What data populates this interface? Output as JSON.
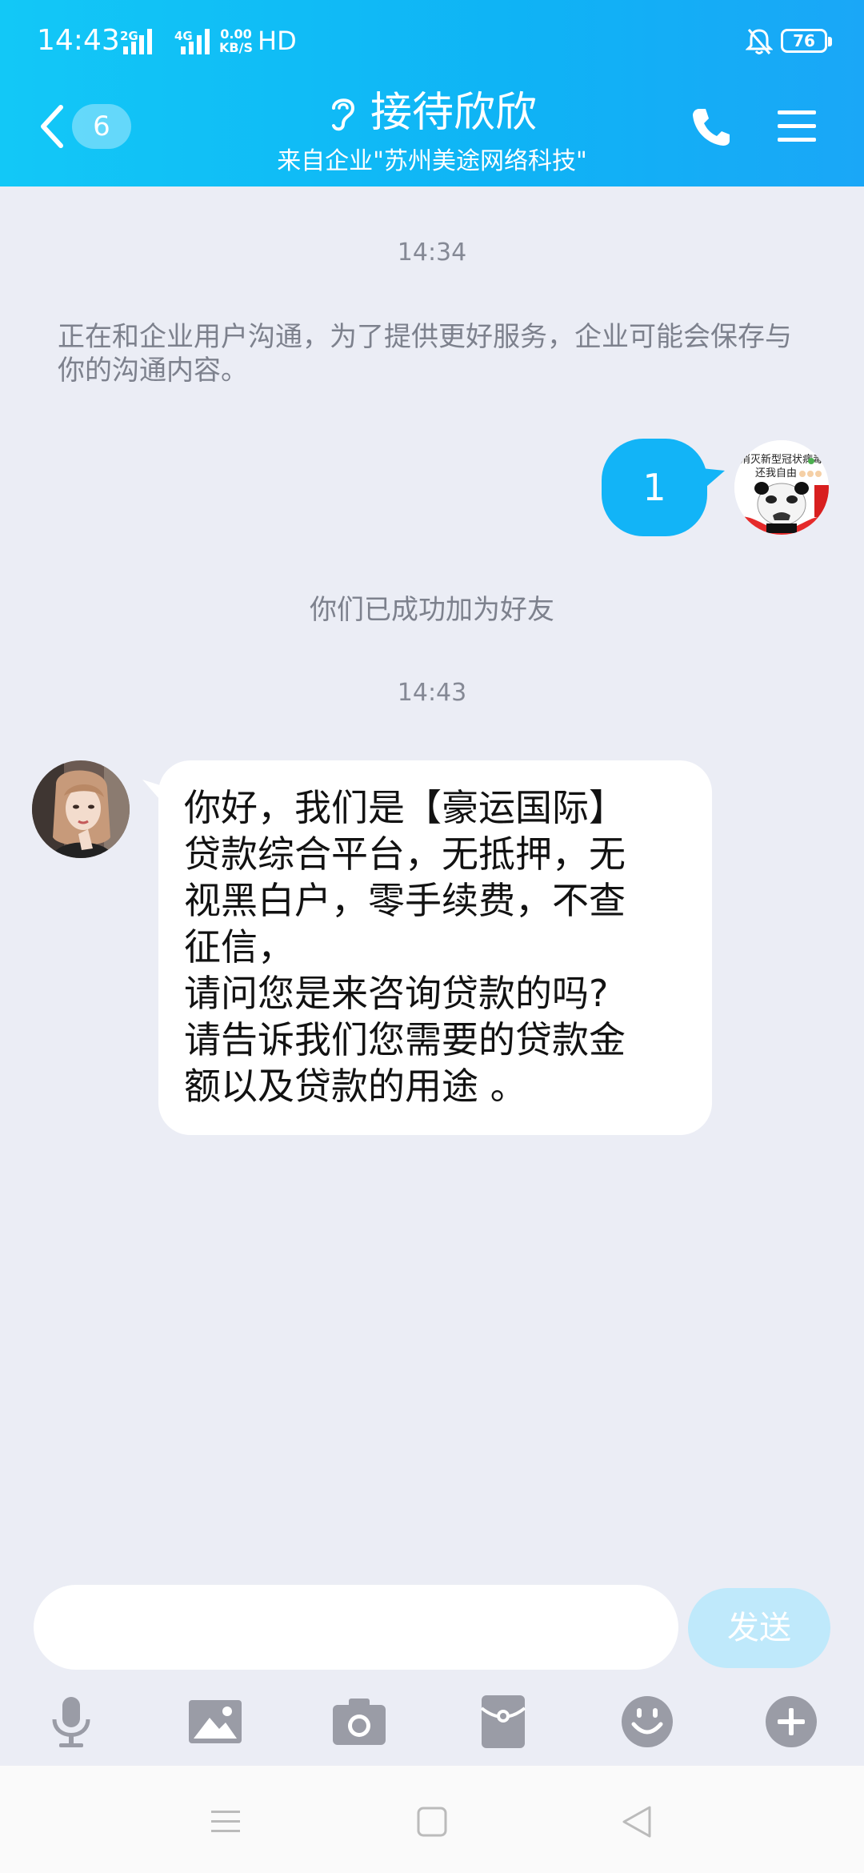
{
  "status_bar": {
    "time": "14:43",
    "network_1": "2G",
    "network_2": "4G",
    "speed_value": "0.00",
    "speed_unit": "KB/S",
    "hd": "HD",
    "battery": "76"
  },
  "header": {
    "unread_count": "6",
    "title": "接待欣欣",
    "subtitle": "来自企业\"苏州美途网络科技\""
  },
  "messages": {
    "timestamp_1": "14:34",
    "notice": "正在和企业用户沟通，为了提供更好服务，企业可能会保存与你的沟通内容。",
    "outgoing_text": "1",
    "avatar_caption_1": "消灭新型冠状病毒",
    "avatar_caption_2": "还我自由",
    "friend_note": "你们已成功加为好友",
    "timestamp_2": "14:43",
    "incoming_lines": [
      "你好，我们是【豪运国际】",
      "贷款综合平台，无抵押，无",
      "视黑白户，零手续费，不查",
      "征信，",
      "请问您是来咨询贷款的吗?",
      "请告诉我们您需要的贷款金",
      "额以及贷款的用途 。"
    ]
  },
  "input_bar": {
    "placeholder": "",
    "send_label": "发送"
  },
  "colors": {
    "header_start": "#12c8f7",
    "header_end": "#1aa7f7",
    "bubble_out": "#12b4f7",
    "bubble_in": "#ffffff",
    "background": "#ebedf5",
    "send_disabled": "#bfe9fb",
    "icon_gray": "#9a9ca6"
  },
  "toolbar": {
    "icons": [
      "microphone-icon",
      "image-icon",
      "camera-icon",
      "red-packet-icon",
      "emoji-icon",
      "plus-icon"
    ]
  }
}
